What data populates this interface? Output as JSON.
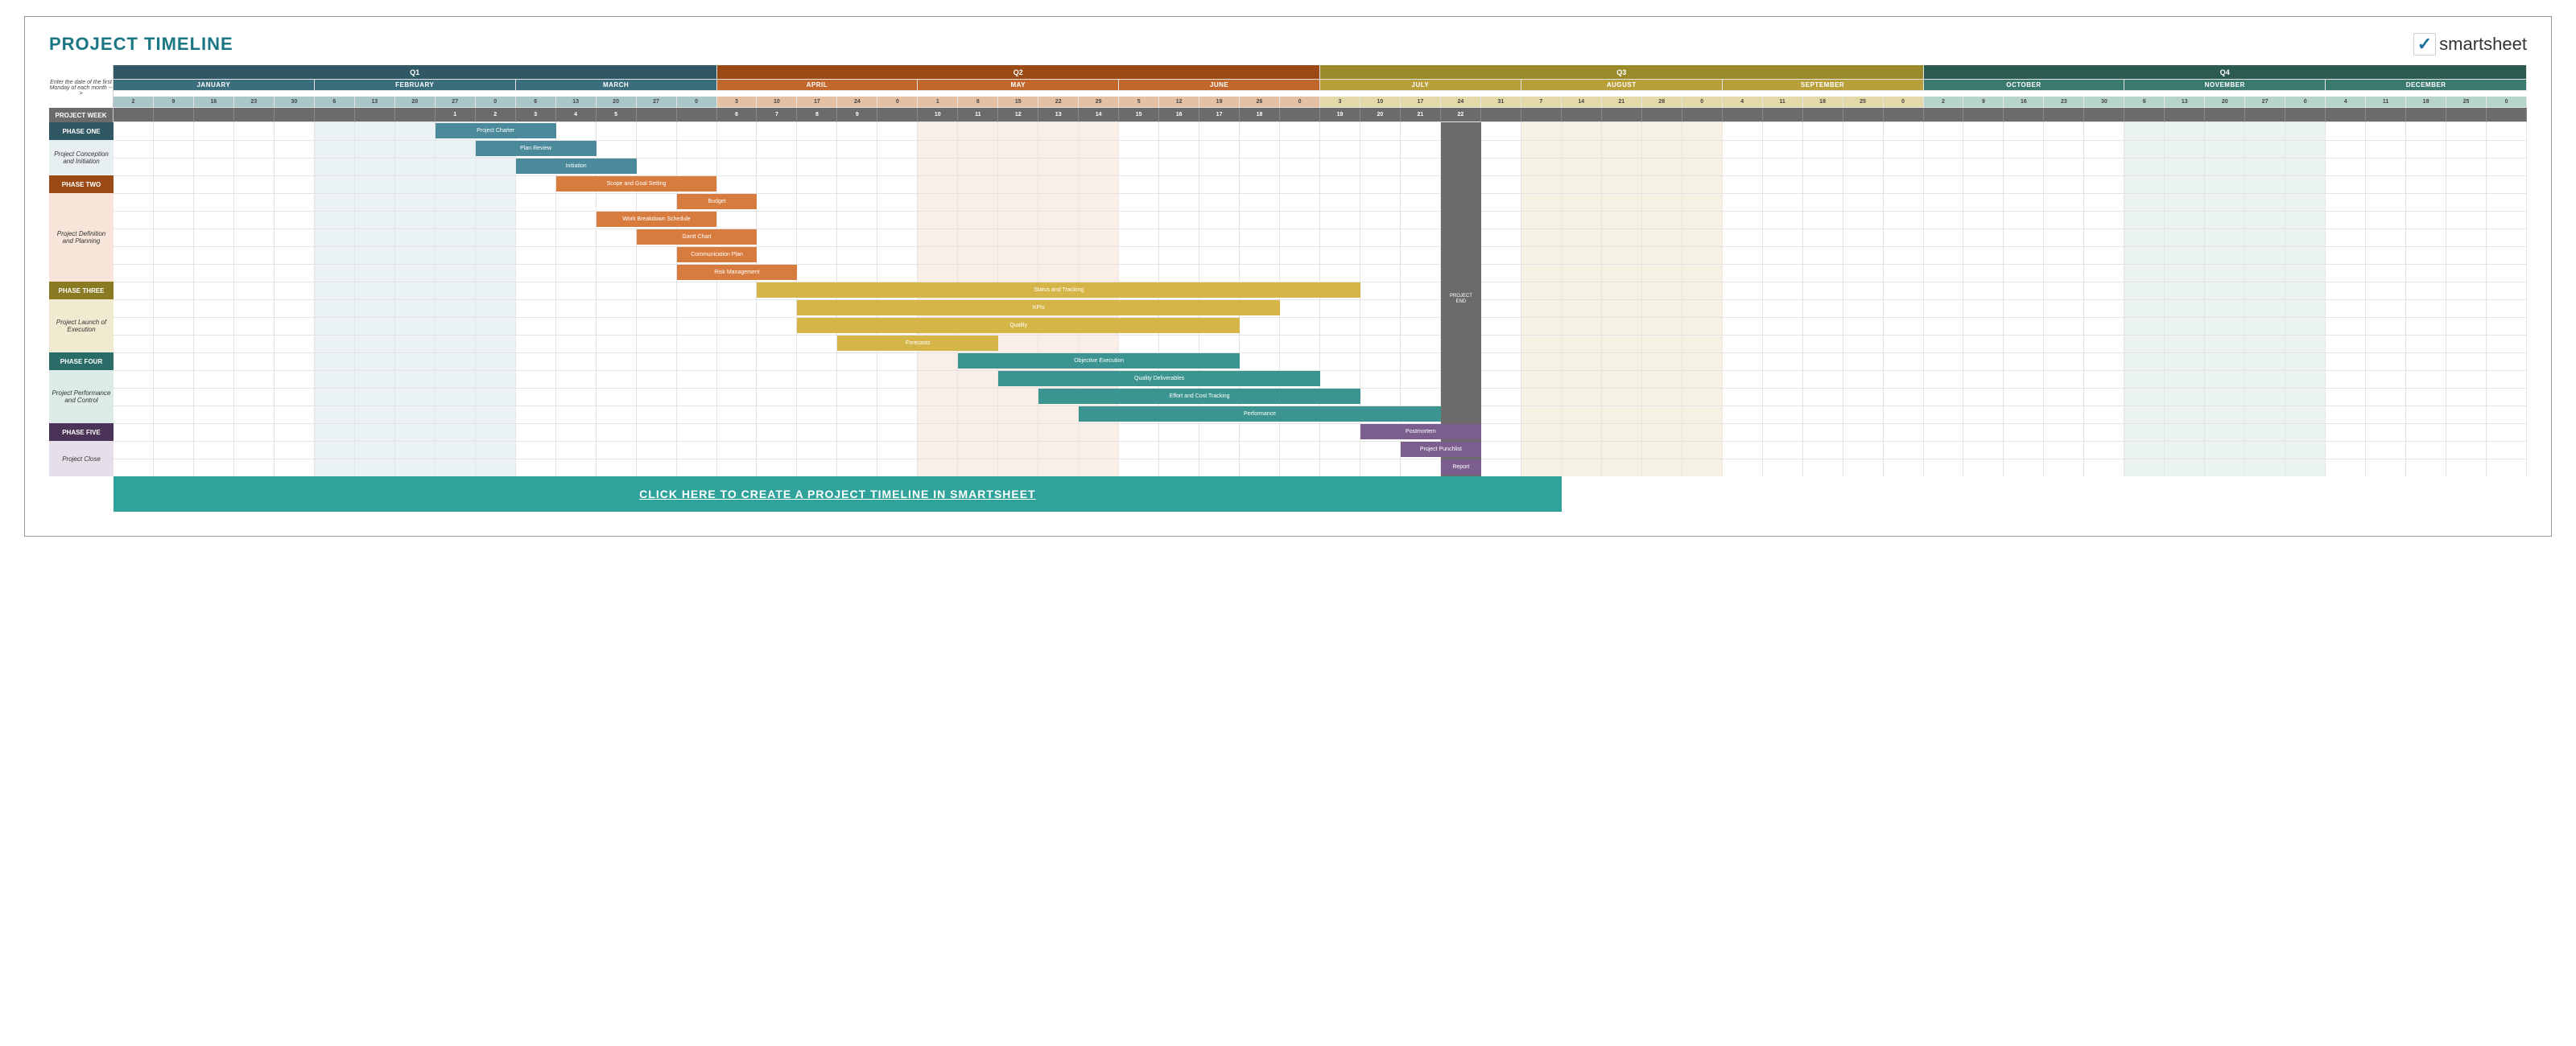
{
  "title": "PROJECT TIMELINE",
  "logo_text": "smartsheet",
  "label_note": "Enter the date of the first Monday of each month -->",
  "project_week_label": "PROJECT WEEK",
  "project_end_label": "PROJECT END",
  "cta_label": "CLICK HERE TO CREATE A PROJECT TIMELINE IN SMARTSHEET",
  "quarters": [
    {
      "label": "Q1",
      "span": 15,
      "bg": "#2f5864"
    },
    {
      "label": "Q2",
      "span": 15,
      "bg": "#9b4a16"
    },
    {
      "label": "Q3",
      "span": 15,
      "bg": "#9b8a2a"
    },
    {
      "label": "Q4",
      "span": 15,
      "bg": "#2a5a50"
    }
  ],
  "months": [
    {
      "label": "JANUARY",
      "span": 5,
      "bg": "#3b6e7c",
      "daybg": "#a9c7c8"
    },
    {
      "label": "FEBRUARY",
      "span": 5,
      "bg": "#3b6e7c",
      "daybg": "#a9c7c8"
    },
    {
      "label": "MARCH",
      "span": 5,
      "bg": "#3b6e7c",
      "daybg": "#a9c7c8"
    },
    {
      "label": "APRIL",
      "span": 5,
      "bg": "#c1672b",
      "daybg": "#e6c0a3"
    },
    {
      "label": "MAY",
      "span": 5,
      "bg": "#c1672b",
      "daybg": "#e6c0a3"
    },
    {
      "label": "JUNE",
      "span": 5,
      "bg": "#c1672b",
      "daybg": "#e6c0a3"
    },
    {
      "label": "JULY",
      "span": 5,
      "bg": "#b89f3a",
      "daybg": "#e4d9a8"
    },
    {
      "label": "AUGUST",
      "span": 5,
      "bg": "#b89f3a",
      "daybg": "#e4d9a8"
    },
    {
      "label": "SEPTEMBER",
      "span": 5,
      "bg": "#b89f3a",
      "daybg": "#e4d9a8"
    },
    {
      "label": "OCTOBER",
      "span": 5,
      "bg": "#3a7a6e",
      "daybg": "#b6d4cc"
    },
    {
      "label": "NOVEMBER",
      "span": 5,
      "bg": "#3a7a6e",
      "daybg": "#b6d4cc"
    },
    {
      "label": "DECEMBER",
      "span": 5,
      "bg": "#3a7a6e",
      "daybg": "#b6d4cc"
    }
  ],
  "days": [
    "2",
    "9",
    "16",
    "23",
    "30",
    "6",
    "13",
    "20",
    "27",
    "0",
    "6",
    "13",
    "20",
    "27",
    "0",
    "3",
    "10",
    "17",
    "24",
    "0",
    "1",
    "8",
    "15",
    "22",
    "29",
    "5",
    "12",
    "19",
    "26",
    "0",
    "3",
    "10",
    "17",
    "24",
    "31",
    "7",
    "14",
    "21",
    "28",
    "0",
    "4",
    "11",
    "18",
    "25",
    "0",
    "2",
    "9",
    "16",
    "23",
    "30",
    "6",
    "13",
    "20",
    "27",
    "0",
    "4",
    "11",
    "18",
    "25",
    "0"
  ],
  "project_weeks": [
    "",
    "",
    "",
    "",
    "",
    "",
    "",
    "",
    "1",
    "2",
    "3",
    "4",
    "5",
    "",
    "",
    "6",
    "7",
    "8",
    "9",
    "",
    "10",
    "11",
    "12",
    "13",
    "14",
    "15",
    "16",
    "17",
    "18",
    "",
    "19",
    "20",
    "21",
    "22",
    "",
    "",
    "",
    "",
    "",
    "",
    "",
    "",
    "",
    "",
    "",
    "",
    "",
    "",
    "",
    "",
    "",
    "",
    "",
    "",
    "",
    "",
    "",
    "",
    "",
    ""
  ],
  "shade_columns": [
    {
      "start": 5,
      "end": 10,
      "color": "#dceaee"
    },
    {
      "start": 20,
      "end": 25,
      "color": "#f7e5d9"
    },
    {
      "start": 35,
      "end": 40,
      "color": "#f0ead1"
    },
    {
      "start": 50,
      "end": 55,
      "color": "#dcebe7"
    }
  ],
  "phases": [
    {
      "id": "phase1",
      "label": "PHASE ONE",
      "sublabel": "Project Conception and Initiation",
      "header_bg": "#2f5864",
      "sub_bg": "#e8eff1",
      "rows": 3,
      "tasks": [
        {
          "label": "Project Charter",
          "start": 8,
          "end": 11,
          "bg": "#4a8a9a"
        },
        {
          "label": "Plan Review",
          "start": 9,
          "end": 12,
          "bg": "#4a8a9a"
        },
        {
          "label": "Initiation",
          "start": 10,
          "end": 13,
          "bg": "#4a8a9a"
        }
      ]
    },
    {
      "id": "phase2",
      "label": "PHASE TWO",
      "sublabel": "Project Definition and Planning",
      "header_bg": "#9b4a16",
      "sub_bg": "#f7e5d9",
      "rows": 6,
      "tasks": [
        {
          "label": "Scope and Goal Setting",
          "start": 11,
          "end": 15,
          "bg": "#d77b3e"
        },
        {
          "label": "Budget",
          "start": 14,
          "end": 16,
          "bg": "#d77b3e"
        },
        {
          "label": "Work Breakdown Schedule",
          "start": 12,
          "end": 15,
          "bg": "#d77b3e"
        },
        {
          "label": "Gantt Chart",
          "start": 13,
          "end": 16,
          "bg": "#d77b3e"
        },
        {
          "label": "Communication Plan",
          "start": 14,
          "end": 16,
          "bg": "#d77b3e"
        },
        {
          "label": "Risk Management",
          "start": 14,
          "end": 17,
          "bg": "#d77b3e"
        }
      ]
    },
    {
      "id": "phase3",
      "label": "PHASE THREE",
      "sublabel": "Project Launch of Execution",
      "header_bg": "#8a7a24",
      "sub_bg": "#f0ead1",
      "rows": 4,
      "tasks": [
        {
          "label": "Status and Tracking",
          "start": 16,
          "end": 31,
          "bg": "#d5b547"
        },
        {
          "label": "KPIs",
          "start": 17,
          "end": 29,
          "bg": "#d5b547"
        },
        {
          "label": "Quality",
          "start": 17,
          "end": 28,
          "bg": "#d5b547"
        },
        {
          "label": "Forecasts",
          "start": 18,
          "end": 22,
          "bg": "#d5b547"
        }
      ]
    },
    {
      "id": "phase4",
      "label": "PHASE FOUR",
      "sublabel": "Project Performance and Control",
      "header_bg": "#2a6d68",
      "sub_bg": "#dcebe7",
      "rows": 4,
      "tasks": [
        {
          "label": "Objective Execution",
          "start": 21,
          "end": 28,
          "bg": "#3c9490"
        },
        {
          "label": "Quality Deliverables",
          "start": 22,
          "end": 30,
          "bg": "#3c9490"
        },
        {
          "label": "Effort and Cost Tracking",
          "start": 23,
          "end": 31,
          "bg": "#3c9490"
        },
        {
          "label": "Performance",
          "start": 24,
          "end": 33,
          "bg": "#3c9490"
        }
      ]
    },
    {
      "id": "phase5",
      "label": "PHASE FIVE",
      "sublabel": "Project Close",
      "header_bg": "#4a3356",
      "sub_bg": "#e6dfe9",
      "rows": 3,
      "tasks": [
        {
          "label": "Postmortem",
          "start": 31,
          "end": 34,
          "bg": "#7b5e8e"
        },
        {
          "label": "Project Punchlist",
          "start": 32,
          "end": 34,
          "bg": "#7b5e8e"
        },
        {
          "label": "Report",
          "start": 33,
          "end": 34,
          "bg": "#7b5e8e"
        }
      ]
    }
  ],
  "chart_data": {
    "type": "table",
    "title": "PROJECT TIMELINE",
    "x_axis": "Project Week",
    "x_range": [
      1,
      34
    ],
    "quarters": [
      "Q1",
      "Q2",
      "Q3",
      "Q4"
    ],
    "months": [
      "JANUARY",
      "FEBRUARY",
      "MARCH",
      "APRIL",
      "MAY",
      "JUNE",
      "JULY",
      "AUGUST",
      "SEPTEMBER",
      "OCTOBER",
      "NOVEMBER",
      "DECEMBER"
    ],
    "month_day_labels": {
      "JANUARY": [
        2,
        9,
        16,
        23,
        30
      ],
      "FEBRUARY": [
        6,
        13,
        20,
        27,
        0
      ],
      "MARCH": [
        6,
        13,
        20,
        27,
        0
      ],
      "APRIL": [
        3,
        10,
        17,
        24,
        0
      ],
      "MAY": [
        1,
        8,
        15,
        22,
        29
      ],
      "JUNE": [
        5,
        12,
        19,
        26,
        0
      ],
      "JULY": [
        3,
        10,
        17,
        24,
        31
      ],
      "AUGUST": [
        7,
        14,
        21,
        28,
        0
      ],
      "SEPTEMBER": [
        4,
        11,
        18,
        25,
        0
      ],
      "OCTOBER": [
        2,
        9,
        16,
        23,
        30
      ],
      "NOVEMBER": [
        6,
        13,
        20,
        27,
        0
      ],
      "DECEMBER": [
        4,
        11,
        18,
        25,
        0
      ]
    },
    "project_end_at_column": 34,
    "series": [
      {
        "phase": "PHASE ONE",
        "group": "Project Conception and Initiation",
        "task": "Project Charter",
        "start_col": 8,
        "end_col": 11
      },
      {
        "phase": "PHASE ONE",
        "group": "Project Conception and Initiation",
        "task": "Plan Review",
        "start_col": 9,
        "end_col": 12
      },
      {
        "phase": "PHASE ONE",
        "group": "Project Conception and Initiation",
        "task": "Initiation",
        "start_col": 10,
        "end_col": 13
      },
      {
        "phase": "PHASE TWO",
        "group": "Project Definition and Planning",
        "task": "Scope and Goal Setting",
        "start_col": 11,
        "end_col": 15
      },
      {
        "phase": "PHASE TWO",
        "group": "Project Definition and Planning",
        "task": "Budget",
        "start_col": 14,
        "end_col": 16
      },
      {
        "phase": "PHASE TWO",
        "group": "Project Definition and Planning",
        "task": "Work Breakdown Schedule",
        "start_col": 12,
        "end_col": 15
      },
      {
        "phase": "PHASE TWO",
        "group": "Project Definition and Planning",
        "task": "Gantt Chart",
        "start_col": 13,
        "end_col": 16
      },
      {
        "phase": "PHASE TWO",
        "group": "Project Definition and Planning",
        "task": "Communication Plan",
        "start_col": 14,
        "end_col": 16
      },
      {
        "phase": "PHASE TWO",
        "group": "Project Definition and Planning",
        "task": "Risk Management",
        "start_col": 14,
        "end_col": 17
      },
      {
        "phase": "PHASE THREE",
        "group": "Project Launch of Execution",
        "task": "Status and Tracking",
        "start_col": 16,
        "end_col": 31
      },
      {
        "phase": "PHASE THREE",
        "group": "Project Launch of Execution",
        "task": "KPIs",
        "start_col": 17,
        "end_col": 29
      },
      {
        "phase": "PHASE THREE",
        "group": "Project Launch of Execution",
        "task": "Quality",
        "start_col": 17,
        "end_col": 28
      },
      {
        "phase": "PHASE THREE",
        "group": "Project Launch of Execution",
        "task": "Forecasts",
        "start_col": 18,
        "end_col": 22
      },
      {
        "phase": "PHASE FOUR",
        "group": "Project Performance and Control",
        "task": "Objective Execution",
        "start_col": 21,
        "end_col": 28
      },
      {
        "phase": "PHASE FOUR",
        "group": "Project Performance and Control",
        "task": "Quality Deliverables",
        "start_col": 22,
        "end_col": 30
      },
      {
        "phase": "PHASE FOUR",
        "group": "Project Performance and Control",
        "task": "Effort and Cost Tracking",
        "start_col": 23,
        "end_col": 31
      },
      {
        "phase": "PHASE FOUR",
        "group": "Project Performance and Control",
        "task": "Performance",
        "start_col": 24,
        "end_col": 33
      },
      {
        "phase": "PHASE FIVE",
        "group": "Project Close",
        "task": "Postmortem",
        "start_col": 31,
        "end_col": 34
      },
      {
        "phase": "PHASE FIVE",
        "group": "Project Close",
        "task": "Project Punchlist",
        "start_col": 32,
        "end_col": 34
      },
      {
        "phase": "PHASE FIVE",
        "group": "Project Close",
        "task": "Report",
        "start_col": 33,
        "end_col": 34
      }
    ]
  }
}
